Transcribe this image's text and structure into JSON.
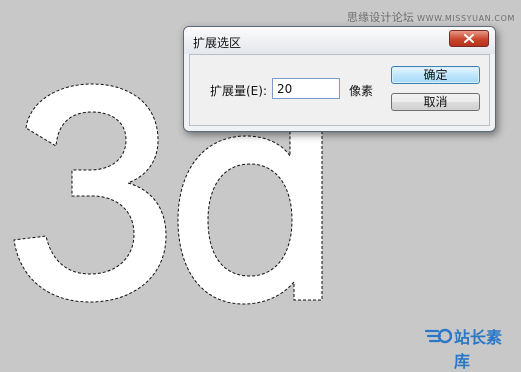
{
  "canvas": {
    "text": "3d"
  },
  "watermark": {
    "site_name": "思缘设计论坛",
    "site_url": "WWW.MISSYUAN.COM",
    "logo_text": "站长素库"
  },
  "dialog": {
    "title": "扩展选区",
    "field_label": "扩展量(E):",
    "field_value": "20",
    "unit": "像素",
    "ok_label": "确定",
    "cancel_label": "取消"
  },
  "colors": {
    "canvas_bg": "#c8c8c8",
    "close_button": "#c9452c",
    "ok_button": "#bee6fd"
  }
}
